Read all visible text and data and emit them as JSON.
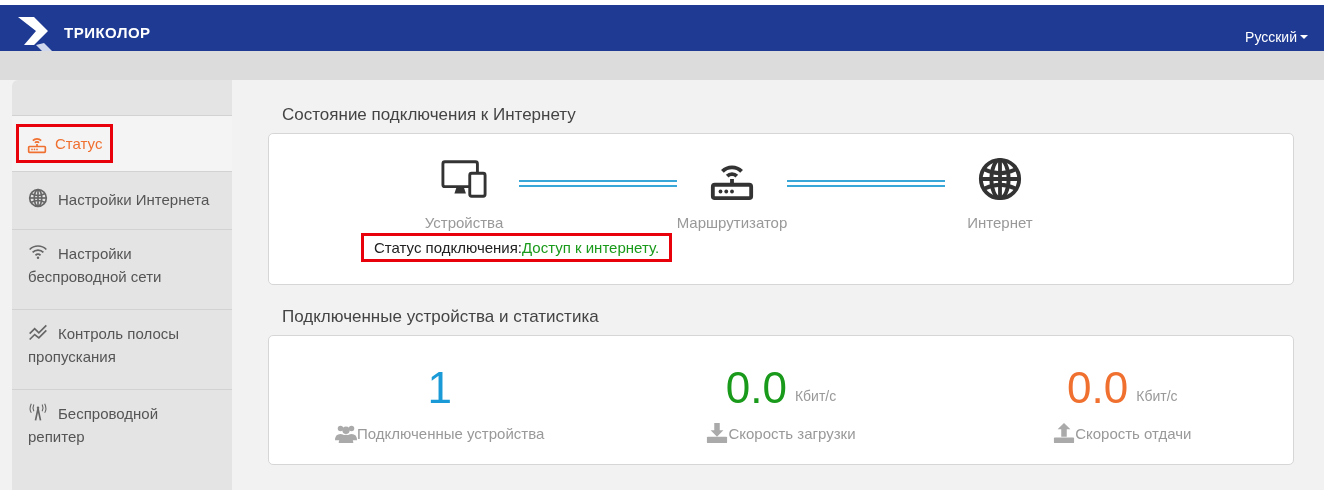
{
  "header": {
    "logo": "ТРИКОЛОР",
    "language": "Русский"
  },
  "sidebar": {
    "items": [
      {
        "label": "Статус",
        "selected": true,
        "highlighted": true
      },
      {
        "label": "Настройки Интернета",
        "selected": false,
        "highlighted": false
      },
      {
        "label": "Настройки беспроводной сети",
        "selected": false,
        "highlighted": false
      },
      {
        "label": "Контроль полосы пропускания",
        "selected": false,
        "highlighted": false
      },
      {
        "label": "Беспроводной репитер",
        "selected": false,
        "highlighted": false
      }
    ]
  },
  "connection": {
    "title": "Состояние подключения к Интернету",
    "nodes": [
      {
        "label": "Устройства"
      },
      {
        "label": "Маршрутизатор"
      },
      {
        "label": "Интернет"
      }
    ],
    "status_label": "Статус подключения:",
    "status_value": "Доступ к интернету.",
    "highlighted": true
  },
  "stats": {
    "title": "Подключенные устройства и статистика",
    "items": [
      {
        "value": "1",
        "label": "Подключенные устройства",
        "color": "#1a9ad6"
      },
      {
        "value": "0.0",
        "unit": "Кбит/с",
        "label": "Скорость загрузки",
        "color": "#1a9a1a"
      },
      {
        "value": "0.0",
        "unit": "Кбит/с",
        "label": "Скорость отдачи",
        "color": "#f07030"
      }
    ]
  }
}
